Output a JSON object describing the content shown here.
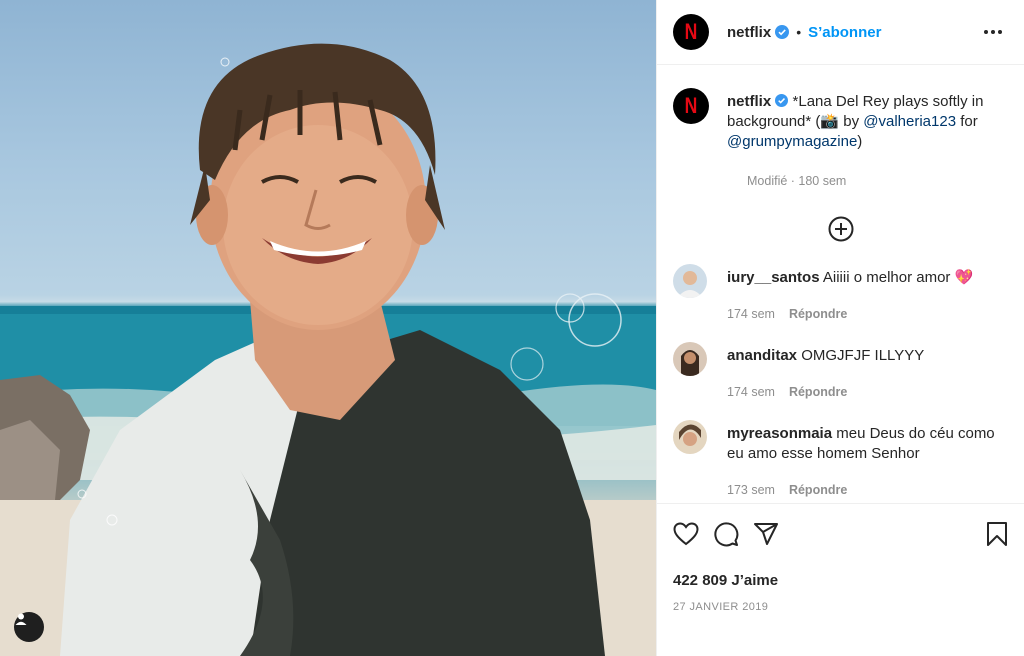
{
  "post": {
    "username": "netflix",
    "follow_label": "S’abonner",
    "dot": "•",
    "brand_letter": "N",
    "brand_color": "#e50914",
    "verified_color": "#3897f0"
  },
  "caption": {
    "username": "netflix",
    "text_before": "*Lana Del Rey plays softly in background* (📸 by ",
    "mention1": "@valheria123",
    "text_mid": " for ",
    "mention2": "@grumpymagazine",
    "text_after": ")",
    "meta": "Modifié · 180 sem"
  },
  "comments": [
    {
      "username": "iury__santos",
      "text": "Aiiiii o melhor amor 💖",
      "time": "174 sem",
      "reply": "Répondre"
    },
    {
      "username": "ananditax",
      "text": "OMGJFJF ILLYYY",
      "time": "174 sem",
      "reply": "Répondre"
    },
    {
      "username": "myreasonmaia",
      "text": "meu Deus do céu como eu amo esse homem Senhor",
      "time": "173 sem",
      "reply": "Répondre"
    }
  ],
  "engagement": {
    "likes": "422 809 J’aime",
    "date": "27 JANVIER 2019"
  },
  "icons": {
    "like": "heart-icon",
    "comment": "comment-icon",
    "share": "share-icon",
    "save": "bookmark-icon",
    "more": "more-icon",
    "add": "plus-circle-icon",
    "user_tag": "user-icon"
  }
}
